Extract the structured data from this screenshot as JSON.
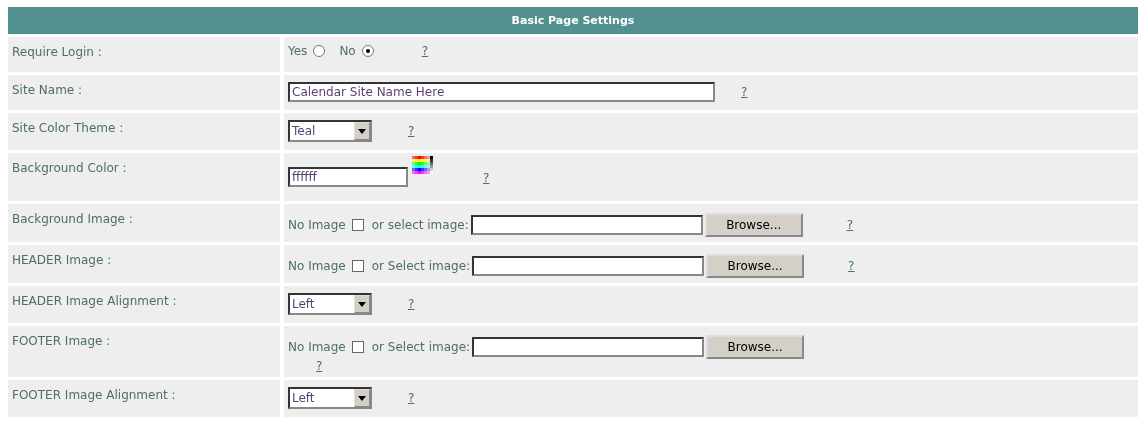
{
  "section_title": "Basic Page Settings",
  "rows": [
    {
      "label": "Require Login :",
      "kind": "radio",
      "options": [
        {
          "label": "Yes",
          "selected": false
        },
        {
          "label": "No",
          "selected": true
        }
      ],
      "help": "?"
    },
    {
      "label": "Site Name :",
      "kind": "text",
      "value": "Calendar Site Name Here",
      "help": "?"
    },
    {
      "label": "Site Color Theme :",
      "kind": "select",
      "value": "Teal",
      "help": "?"
    },
    {
      "label": "Background Color :",
      "kind": "color",
      "value": "ffffff",
      "help": "?"
    },
    {
      "label": "Background Image :",
      "kind": "file",
      "checkbox_label": "No Image",
      "checked": false,
      "select_label": "or select image:",
      "button": "Browse...",
      "help": "?"
    },
    {
      "label": "HEADER Image :",
      "kind": "file",
      "checkbox_label": "No Image",
      "checked": false,
      "select_label": "or Select image:",
      "button": "Browse...",
      "help": "?"
    },
    {
      "label": "HEADER Image Alignment :",
      "kind": "select",
      "value": "Left",
      "help": "?"
    },
    {
      "label": "FOOTER Image :",
      "kind": "file",
      "checkbox_label": "No Image",
      "checked": false,
      "select_label": "or Select image:",
      "button": "Browse...",
      "help": "?",
      "help_below": true
    },
    {
      "label": "FOOTER Image Alignment :",
      "kind": "select",
      "value": "Left",
      "help": "?"
    }
  ]
}
